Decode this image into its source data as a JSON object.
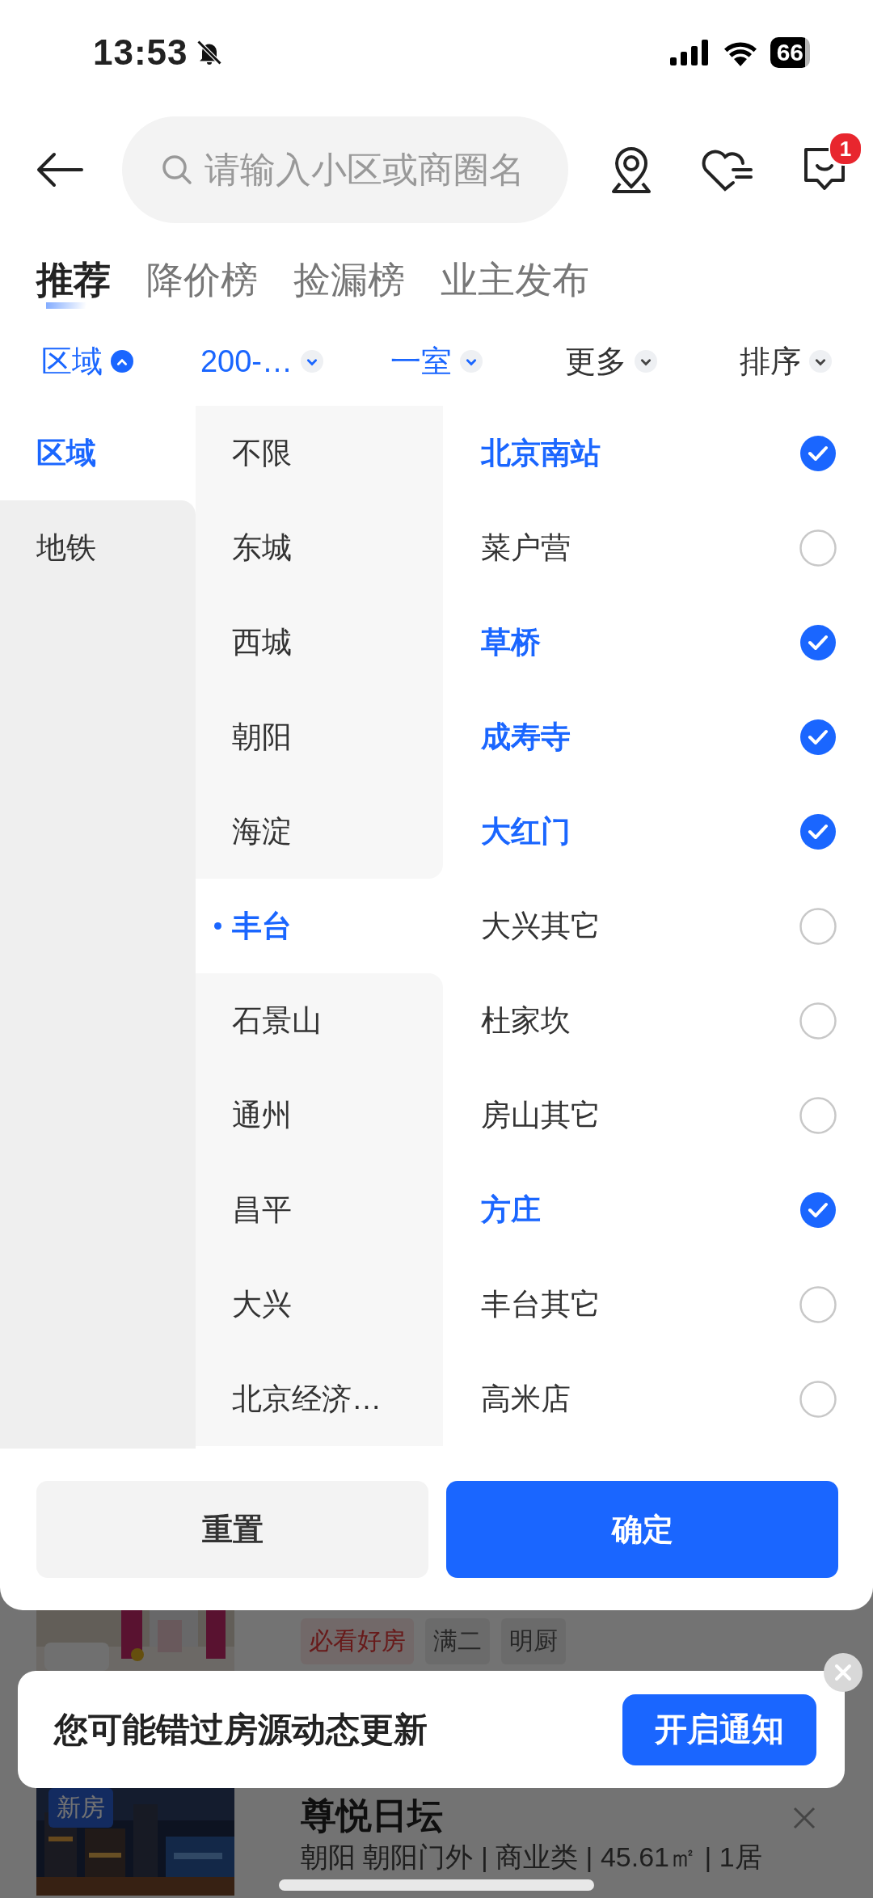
{
  "status_bar": {
    "time": "13:53",
    "battery": "66"
  },
  "search": {
    "placeholder": "请输入小区或商圈名"
  },
  "message_badge": "1",
  "tabs": [
    {
      "label": "推荐",
      "selected": true
    },
    {
      "label": "降价榜",
      "selected": false
    },
    {
      "label": "捡漏榜",
      "selected": false
    },
    {
      "label": "业主发布",
      "selected": false
    }
  ],
  "filters": [
    {
      "label": "区域",
      "active": true,
      "expanded": true
    },
    {
      "label": "200-…",
      "active": true,
      "expanded": false
    },
    {
      "label": "一室",
      "active": true,
      "expanded": false
    },
    {
      "label": "更多",
      "active": false,
      "expanded": false
    },
    {
      "label": "排序",
      "active": false,
      "expanded": false
    }
  ],
  "categories": [
    {
      "label": "区域",
      "selected": true
    },
    {
      "label": "地铁",
      "selected": false
    }
  ],
  "districts": [
    {
      "label": "不限",
      "selected": false
    },
    {
      "label": "东城",
      "selected": false
    },
    {
      "label": "西城",
      "selected": false
    },
    {
      "label": "朝阳",
      "selected": false
    },
    {
      "label": "海淀",
      "selected": false
    },
    {
      "label": "丰台",
      "selected": true
    },
    {
      "label": "石景山",
      "selected": false
    },
    {
      "label": "通州",
      "selected": false
    },
    {
      "label": "昌平",
      "selected": false
    },
    {
      "label": "大兴",
      "selected": false
    },
    {
      "label": "北京经济…",
      "selected": false
    }
  ],
  "areas": [
    {
      "label": "北京南站",
      "checked": true
    },
    {
      "label": "菜户营",
      "checked": false
    },
    {
      "label": "草桥",
      "checked": true
    },
    {
      "label": "成寿寺",
      "checked": true
    },
    {
      "label": "大红门",
      "checked": true
    },
    {
      "label": "大兴其它",
      "checked": false
    },
    {
      "label": "杜家坎",
      "checked": false
    },
    {
      "label": "房山其它",
      "checked": false
    },
    {
      "label": "方庄",
      "checked": true
    },
    {
      "label": "丰台其它",
      "checked": false
    },
    {
      "label": "高米店",
      "checked": false
    }
  ],
  "buttons": {
    "reset": "重置",
    "confirm": "确定"
  },
  "listings": [
    {
      "tags": [
        {
          "label": "必看好房",
          "kind": "highlight"
        },
        {
          "label": "满二",
          "kind": "plain"
        },
        {
          "label": "明厨",
          "kind": "plain"
        }
      ]
    },
    {
      "badge": "新房",
      "title": "尊悦日坛",
      "subtitle": "朝阳 朝阳门外 | 商业类 | 45.61㎡ | 1居"
    }
  ],
  "notice": {
    "text": "您可能错过房源动态更新",
    "button": "开启通知"
  }
}
